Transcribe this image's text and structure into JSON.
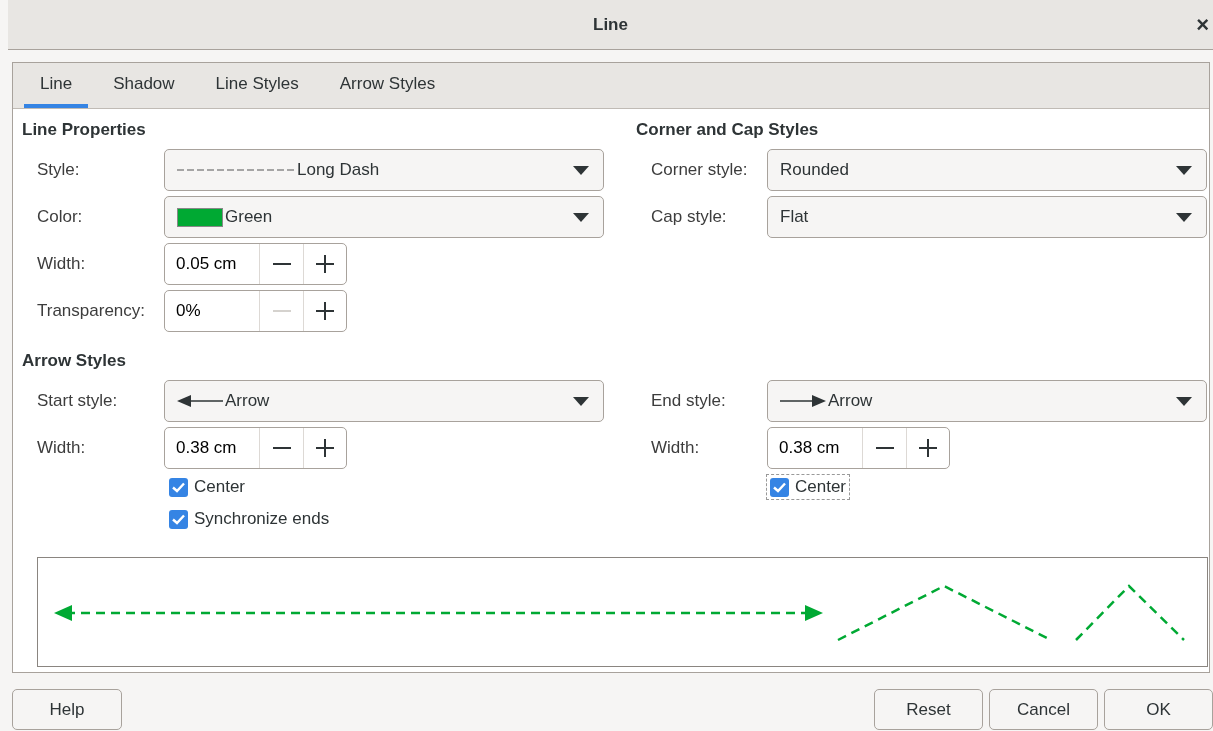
{
  "window": {
    "title": "Line",
    "close": "×"
  },
  "tabs": [
    {
      "label": "Line",
      "selected": true
    },
    {
      "label": "Shadow",
      "selected": false
    },
    {
      "label": "Line Styles",
      "selected": false
    },
    {
      "label": "Arrow Styles",
      "selected": false
    }
  ],
  "line_properties": {
    "heading": "Line Properties",
    "rows": [
      {
        "kind": "dropdown",
        "label": "Style:",
        "value": "Long Dash",
        "preview": {
          "kind": "dash"
        }
      },
      {
        "kind": "dropdown",
        "label": "Color:",
        "value": "Green",
        "preview": {
          "kind": "swatch",
          "color": "#00a933"
        }
      },
      {
        "kind": "spin",
        "label": "Width:",
        "value": "0.05 cm",
        "minus_disabled": false
      },
      {
        "kind": "spin",
        "label": "Transparency:",
        "value": "0%",
        "minus_disabled": true
      }
    ]
  },
  "corner_and_cap": {
    "heading": "Corner and Cap Styles",
    "rows": [
      {
        "kind": "dropdown",
        "label": "Corner style:",
        "value": "Rounded"
      },
      {
        "kind": "dropdown",
        "label": "Cap style:",
        "value": "Flat"
      }
    ]
  },
  "arrow_styles": {
    "heading": "Arrow Styles",
    "start": {
      "rows": [
        {
          "kind": "dropdown",
          "label": "Start style:",
          "value": "Arrow",
          "preview": {
            "kind": "arrow-left"
          }
        },
        {
          "kind": "spin",
          "label": "Width:",
          "value": "0.38 cm",
          "minus_disabled": false
        }
      ],
      "checkboxes": [
        {
          "label": "Center",
          "checked": true,
          "focused": false
        },
        {
          "label": "Synchronize ends",
          "checked": true,
          "focused": false
        }
      ]
    },
    "end": {
      "rows": [
        {
          "kind": "dropdown",
          "label": "End style:",
          "value": "Arrow",
          "preview": {
            "kind": "arrow-right"
          }
        },
        {
          "kind": "spin",
          "label": "Width:",
          "value": "0.38 cm",
          "minus_disabled": false
        }
      ],
      "checkboxes": [
        {
          "label": "Center",
          "checked": true,
          "focused": true
        }
      ]
    }
  },
  "buttons_left": [
    "Help"
  ],
  "buttons_right": [
    "Reset",
    "Cancel",
    "OK"
  ]
}
